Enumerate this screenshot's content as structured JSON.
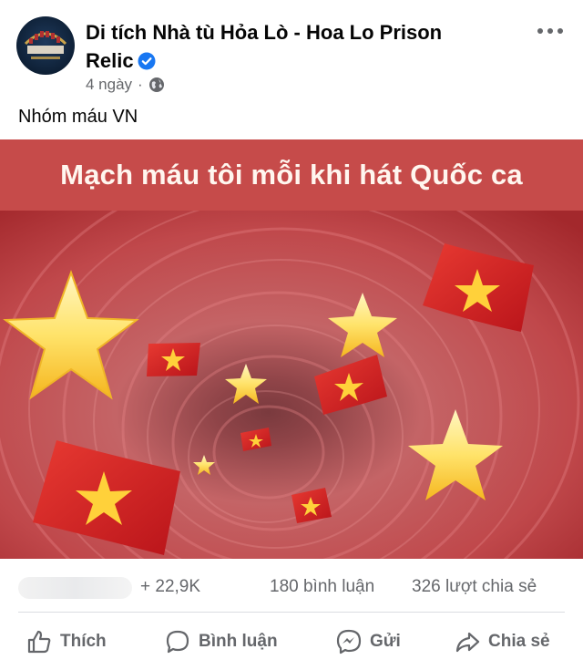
{
  "post": {
    "author": "Di tích Nhà tù Hỏa Lò - Hoa Lo Prison Relic",
    "timestamp": "4 ngày",
    "separator": "·",
    "caption": "Nhóm máu VN",
    "avatar_text": "HOA LO PRISON"
  },
  "image": {
    "banner_text": "Mạch máu tôi mỗi khi hát Quốc ca"
  },
  "stats": {
    "reactions": "+ 22,9K",
    "comments": "180 bình luận",
    "shares": "326 lượt chia sẻ"
  },
  "actions": {
    "like": "Thích",
    "comment": "Bình luận",
    "send": "Gửi",
    "share": "Chia sẻ"
  },
  "colors": {
    "verified_blue": "#1877f2",
    "flag_red": "#da251d",
    "star_yellow": "#ffd13a",
    "banner_red": "#c64b4a"
  }
}
